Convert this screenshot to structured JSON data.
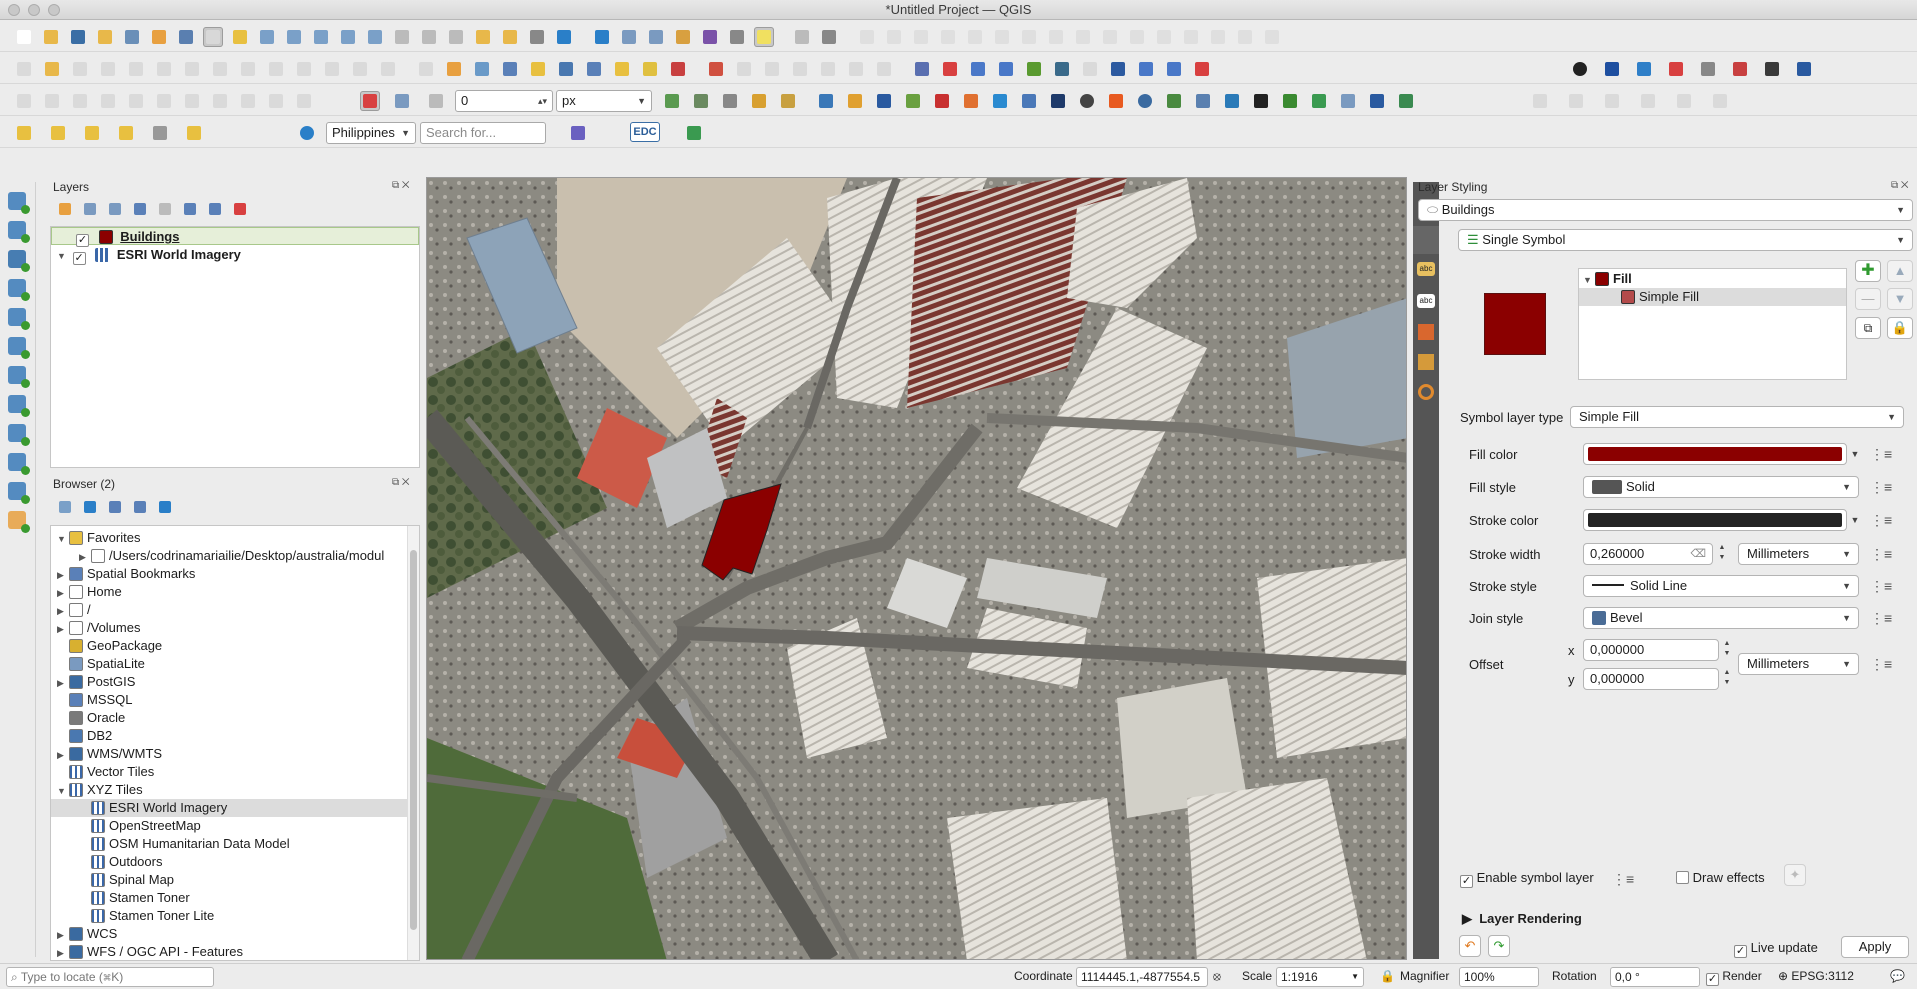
{
  "window": {
    "title": "*Untitled Project — QGIS"
  },
  "toolbar": {
    "snapping_tolerance": "0",
    "snapping_units": "px",
    "geocoder_country": "Philippines",
    "search_placeholder": "Search for...",
    "edc_label": "EDC"
  },
  "layers_panel": {
    "title": "Layers",
    "layers": [
      {
        "name": "Buildings",
        "checked": true,
        "selected": true,
        "color": "#8b0000"
      },
      {
        "name": "ESRI World Imagery",
        "checked": true,
        "selected": false
      }
    ]
  },
  "browser_panel": {
    "title": "Browser (2)",
    "items": [
      {
        "label": "Favorites",
        "icon": "star-icon",
        "expanded": true
      },
      {
        "label": "/Users/codrinamariailie/Desktop/australia/modul",
        "icon": "folder-icon"
      },
      {
        "label": "Spatial Bookmarks",
        "icon": "bookmark-icon"
      },
      {
        "label": "Home",
        "icon": "home-icon"
      },
      {
        "label": "/",
        "icon": "folder-icon"
      },
      {
        "label": "/Volumes",
        "icon": "folder-icon"
      },
      {
        "label": "GeoPackage",
        "icon": "geopackage-icon"
      },
      {
        "label": "SpatiaLite",
        "icon": "spatialite-icon"
      },
      {
        "label": "PostGIS",
        "icon": "postgis-icon"
      },
      {
        "label": "MSSQL",
        "icon": "mssql-icon"
      },
      {
        "label": "Oracle",
        "icon": "oracle-icon"
      },
      {
        "label": "DB2",
        "icon": "db2-icon"
      },
      {
        "label": "WMS/WMTS",
        "icon": "globe-icon"
      },
      {
        "label": "Vector Tiles",
        "icon": "grid-icon"
      },
      {
        "label": "XYZ Tiles",
        "icon": "grid-icon",
        "expanded": true
      },
      {
        "label": "ESRI World Imagery",
        "icon": "grid-icon",
        "selected": true
      },
      {
        "label": "OpenStreetMap",
        "icon": "grid-icon"
      },
      {
        "label": "OSM Humanitarian Data Model",
        "icon": "grid-icon"
      },
      {
        "label": "Outdoors",
        "icon": "grid-icon"
      },
      {
        "label": "Spinal Map",
        "icon": "grid-icon"
      },
      {
        "label": "Stamen Toner",
        "icon": "grid-icon"
      },
      {
        "label": "Stamen Toner Lite",
        "icon": "grid-icon"
      },
      {
        "label": "WCS",
        "icon": "globe-icon"
      },
      {
        "label": "WFS / OGC API - Features",
        "icon": "globe-icon"
      }
    ]
  },
  "styling": {
    "title": "Layer Styling",
    "layer": "Buildings",
    "renderer": "Single Symbol",
    "symbol_tree": {
      "root": "Fill",
      "child": "Simple Fill"
    },
    "preview_color": "#8b0000",
    "symbol_layer_type_label": "Symbol layer type",
    "symbol_layer_type": "Simple Fill",
    "fill_color_label": "Fill color",
    "fill_color": "#8b0000",
    "fill_style_label": "Fill style",
    "fill_style": "Solid",
    "stroke_color_label": "Stroke color",
    "stroke_color": "#232323",
    "stroke_width_label": "Stroke width",
    "stroke_width": "0,260000",
    "stroke_width_unit": "Millimeters",
    "stroke_style_label": "Stroke style",
    "stroke_style": "Solid Line",
    "join_style_label": "Join style",
    "join_style": "Bevel",
    "offset_label": "Offset",
    "offset_x_label": "x",
    "offset_x": "0,000000",
    "offset_y_label": "y",
    "offset_y": "0,000000",
    "offset_unit": "Millimeters",
    "enable_symbol_layer": "Enable symbol layer",
    "draw_effects": "Draw effects",
    "layer_rendering": "Layer Rendering",
    "live_update": "Live update",
    "apply": "Apply"
  },
  "statusbar": {
    "locator_placeholder": "Type to locate (⌘K)",
    "coordinate_label": "Coordinate",
    "coordinate": "1114445.1,-4877554.5",
    "scale_label": "Scale",
    "scale": "1:1916",
    "magnifier_label": "Magnifier",
    "magnifier": "100%",
    "rotation_label": "Rotation",
    "rotation": "0,0 °",
    "render_label": "Render",
    "crs": "EPSG:3112"
  }
}
